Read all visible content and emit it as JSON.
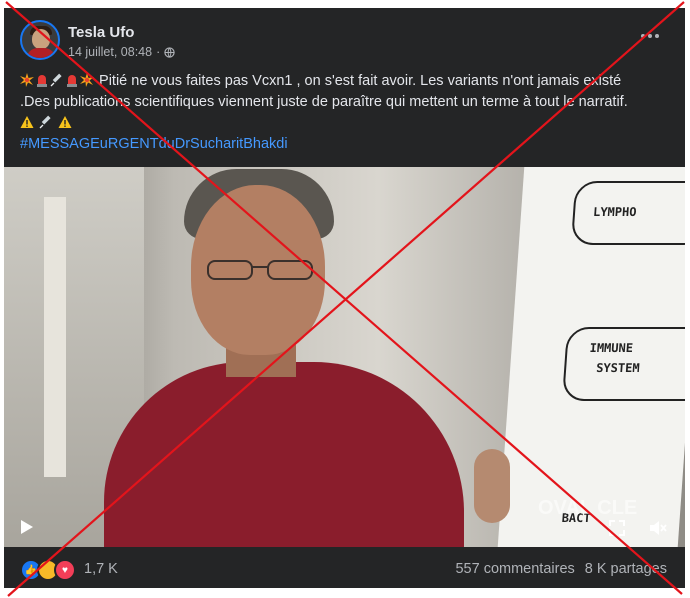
{
  "post": {
    "author": "Tesla Ufo",
    "date": "14 juillet, 08:48",
    "separator": "·",
    "text_line1": "Pitié ne vous faites pas Vcxn1 , on s'est fait avoir. Les variants n'ont jamais existé",
    "text_line2": ".Des publications scientifiques viennent juste de paraître qui mettent un terme à tout le narratif.",
    "hashtag": "#MESSAGEuRGENTduDrSucharitBhakdi",
    "emoji_line1": [
      "collision-icon",
      "siren-icon",
      "syringe-icon",
      "siren-icon",
      "collision-icon"
    ],
    "emoji_line3": [
      "warning-icon",
      "syringe-icon",
      "warning-icon"
    ]
  },
  "video": {
    "whiteboard_words": [
      "LYMPHO",
      "IMMUNE",
      "SYSTEM",
      "BACT"
    ],
    "watermark": "OVAL CLE"
  },
  "footer": {
    "reaction_icons": [
      "like-icon",
      "haha-icon",
      "love-icon"
    ],
    "reaction_count": "1,7 K",
    "comments": "557 commentaires",
    "shares": "8 K partages"
  },
  "overlay": {
    "color": "#e3141b"
  },
  "colors": {
    "card_bg": "#242526",
    "hashtag": "#4599ff",
    "text": "#e4e6eb",
    "muted": "#b0b3b8"
  }
}
